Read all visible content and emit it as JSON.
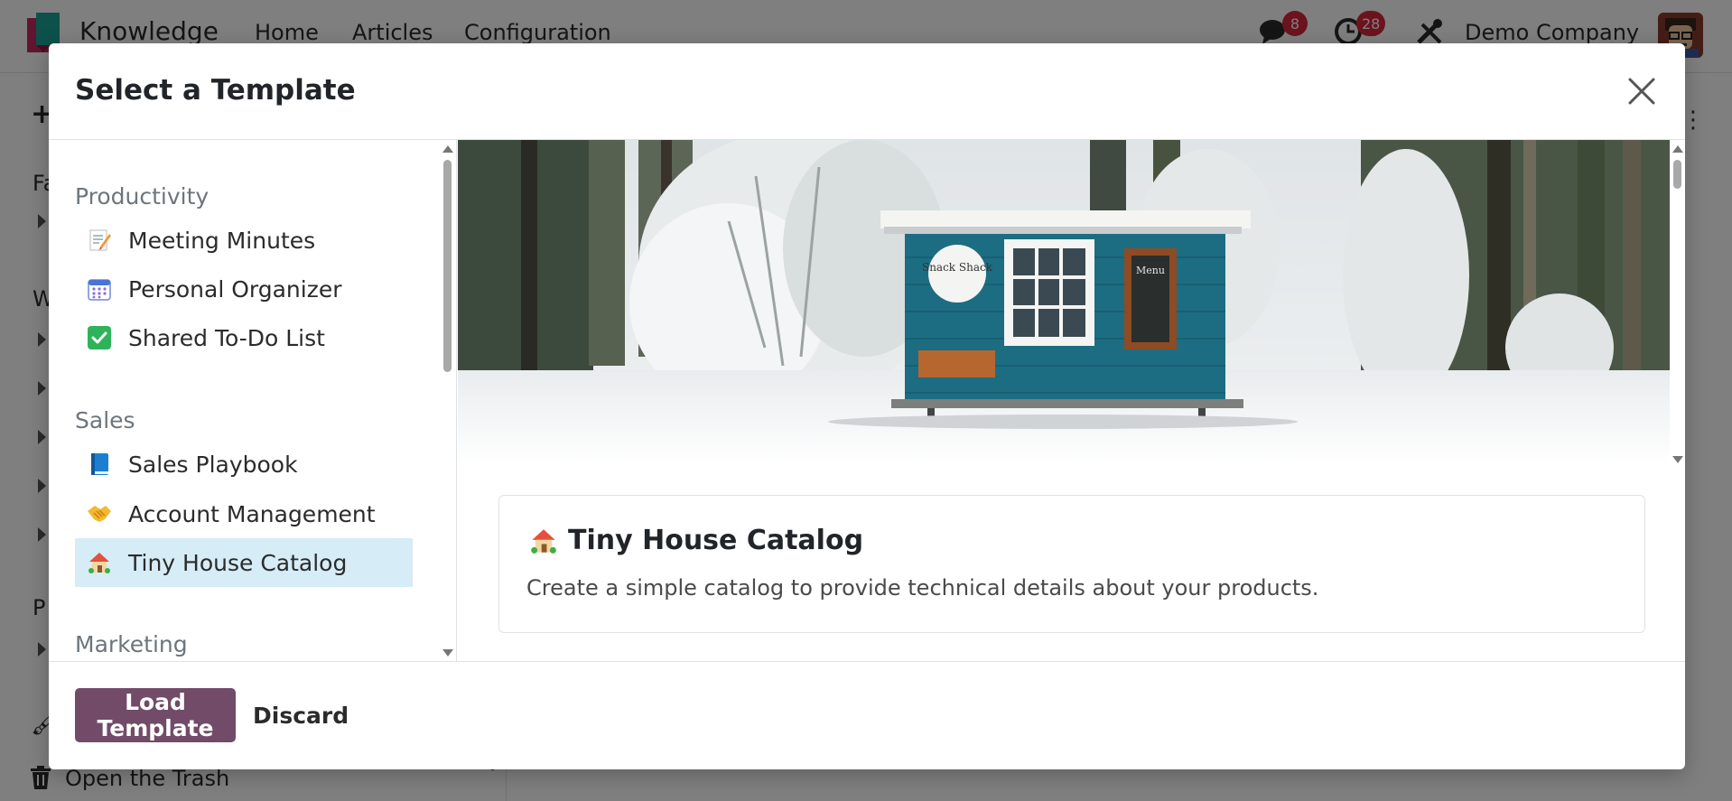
{
  "app": {
    "name": "Knowledge",
    "menu": [
      "Home",
      "Articles",
      "Configuration"
    ],
    "messages_count": "8",
    "activities_count": "28",
    "company": "Demo Company"
  },
  "sidebar": {
    "partial_labels": [
      "Fa",
      "W",
      "P"
    ],
    "trash_label": "Open the Trash"
  },
  "dialog": {
    "title": "Select a Template",
    "groups": [
      {
        "label": "Productivity",
        "items": [
          {
            "label": "Meeting Minutes",
            "icon": "memo-emoji"
          },
          {
            "label": "Personal Organizer",
            "icon": "calendar-emoji"
          },
          {
            "label": "Shared To-Do List",
            "icon": "check-mark-button-emoji"
          }
        ]
      },
      {
        "label": "Sales",
        "items": [
          {
            "label": "Sales Playbook",
            "icon": "blue-book-emoji"
          },
          {
            "label": "Account Management",
            "icon": "handshake-emoji"
          },
          {
            "label": "Tiny House Catalog",
            "icon": "house-with-garden-emoji",
            "selected": true
          }
        ]
      },
      {
        "label": "Marketing",
        "items": []
      }
    ],
    "preview": {
      "title": "Tiny House Catalog",
      "description": "Create a simple catalog to provide technical details about your products.",
      "cover_sign": "Snack Shack",
      "cover_menu": "Menu"
    },
    "buttons": {
      "load": "Load Template",
      "discard": "Discard"
    }
  },
  "colors": {
    "brand": "#714b67",
    "selected_bg": "#d6ecf7",
    "badge": "#d9263d"
  }
}
